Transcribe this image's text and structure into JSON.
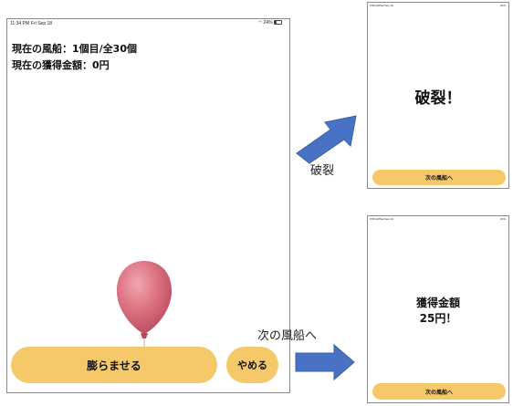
{
  "main_screen": {
    "status": {
      "time": "11:34 PM",
      "date": "Fri Sep 18",
      "battery": "24%",
      "battery_level": 0.24
    },
    "current_balloon_label": "現在の風船：1個目/全30個",
    "current_amount_label": "現在の獲得金額：0円",
    "inflate_button": "膨らませる",
    "stop_button": "やめる"
  },
  "burst_screen": {
    "status": {
      "time": "9:59 AM",
      "date": "Sat Sep 19",
      "battery": "91%"
    },
    "message": "破裂！",
    "next_button": "次の風船へ"
  },
  "earned_screen": {
    "status": {
      "time": "9:59 AM",
      "date": "Sat Sep 19",
      "battery": "91%"
    },
    "message_line1": "獲得金額",
    "message_line2": "25円！",
    "next_button": "次の風船へ"
  },
  "arrows": {
    "burst_label": "破裂",
    "next_label": "次の風船へ"
  },
  "colors": {
    "button": "#f5c96a",
    "arrow": "#4a72c4",
    "balloon": "#d86c7a"
  }
}
